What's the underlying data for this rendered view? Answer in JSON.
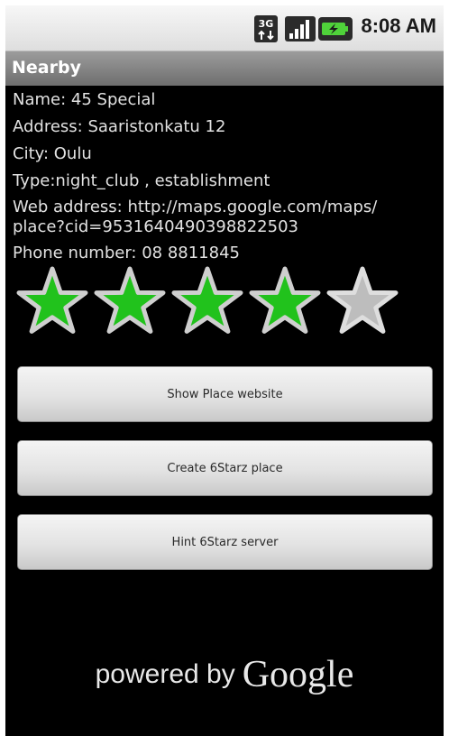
{
  "status_bar": {
    "network_type": "3G",
    "time": "8:08 AM",
    "icons": [
      "3g-icon",
      "signal-icon",
      "battery-charging-icon"
    ]
  },
  "title_bar": {
    "title": "Nearby"
  },
  "place": {
    "name_line": "Name: 45 Special",
    "address_line": "Address: Saaristonkatu 12",
    "city_line": "City:  Oulu",
    "type_line": "Type:night_club , establishment",
    "web_line_1": "Web address: http://maps.google.com/maps/",
    "web_line_2": "place?cid=9531640490398822503",
    "phone_line": "Phone number: 08 8811845"
  },
  "rating": {
    "value": 4,
    "max": 5,
    "filled_color": "#21c21c",
    "empty_color": "#bdbdbd"
  },
  "buttons": {
    "website": "Show Place website",
    "create": "Create 6Starz place",
    "hint": "Hint 6Starz server"
  },
  "footer": {
    "powered_by": "powered by",
    "brand": "Google"
  }
}
